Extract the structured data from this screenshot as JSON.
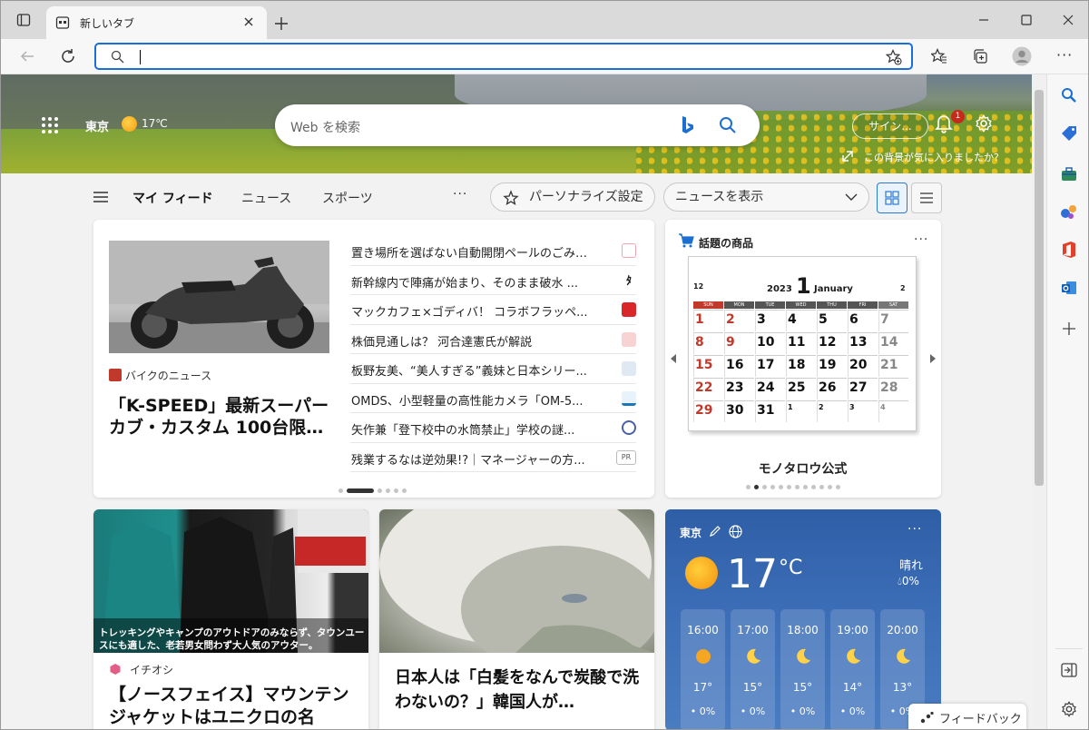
{
  "tab": {
    "title": "新しいタブ"
  },
  "hero": {
    "city": "東京",
    "temp": "17℃",
    "search_placeholder": "Web を検索",
    "signin_label": "サイン...",
    "notif_count": "1",
    "like_bg_label": "この背景が気に入りましたか?"
  },
  "nav": {
    "my_feed": "マイ フィード",
    "news": "ニュース",
    "sports": "スポーツ",
    "more": "···",
    "personalize": "パーソナライズ設定",
    "show_news": "ニュースを表示"
  },
  "main_card": {
    "source": "バイクのニュース",
    "headline": "「K-SPEED」最新スーパーカブ・カスタム 100台限…",
    "list": [
      {
        "text": "置き場所を選ばない自動開閉ペールのごみ…",
        "color": "#f2d6da"
      },
      {
        "text": "新幹線内で陣痛が始まり、そのまま破水 ...",
        "color": "#222222"
      },
      {
        "text": "マックカフェ×ゴディバ！ コラボフラッペ...",
        "color": "#d9262b"
      },
      {
        "text": "株価見通しは？ 河合達憲氏が解説",
        "color": "#f4c7c7"
      },
      {
        "text": "板野友美、“美人すぎる”義妹と日本シリー...",
        "color": "#d9e4f2"
      },
      {
        "text": "OMDS、小型軽量の高性能カメラ「OM-5...",
        "color": "#1a79b5"
      },
      {
        "text": "矢作兼「登下校中の水筒禁止」学校の謎...",
        "color": "#4a5fa8"
      },
      {
        "text": "残業するなは逆効果!?｜マネージャーの方...",
        "color": "#ffffff"
      }
    ],
    "pr_label": "PR"
  },
  "shop_card": {
    "title": "話題の商品",
    "name": "モノタロウ公式",
    "calendar": {
      "year": "2023",
      "month_num": "1",
      "month_name": "January",
      "prev_month": "12",
      "next_month": "2",
      "weekdays": [
        "SUN",
        "MON",
        "TUE",
        "WED",
        "THU",
        "FRI",
        "SAT"
      ],
      "weeks": [
        [
          "1",
          "2",
          "3",
          "4",
          "5",
          "6",
          "7"
        ],
        [
          "8",
          "9",
          "10",
          "11",
          "12",
          "13",
          "14"
        ],
        [
          "15",
          "16",
          "17",
          "18",
          "19",
          "20",
          "21"
        ],
        [
          "22",
          "23",
          "24",
          "25",
          "26",
          "27",
          "28"
        ],
        [
          "29",
          "30",
          "31",
          "1",
          "2",
          "3",
          "4"
        ]
      ]
    }
  },
  "card_jacket": {
    "overlay_text": "トレッキングやキャンプのアウトドアのみならず、タウンユースにも適した、老若男女問わず大人気のアウター。",
    "source": "イチオシ",
    "headline": "【ノースフェイス】マウンテンジャケットはユニクロの名"
  },
  "card_lion": {
    "headline": "日本人は「白髪をなんで炭酸で洗わないの？」韓国人が…"
  },
  "weather": {
    "city": "東京",
    "temp": "17",
    "unit": "°C",
    "condition": "晴れ",
    "precip": "0%",
    "hours": [
      {
        "time": "16:00",
        "icon": "sun",
        "temp": "17°",
        "precip": "0%"
      },
      {
        "time": "17:00",
        "icon": "moon",
        "temp": "15°",
        "precip": "0%"
      },
      {
        "time": "18:00",
        "icon": "moon",
        "temp": "15°",
        "precip": "0%"
      },
      {
        "time": "19:00",
        "icon": "moon",
        "temp": "14°",
        "precip": "0%"
      },
      {
        "time": "20:00",
        "icon": "moon",
        "temp": "13°",
        "precip": "0%"
      }
    ]
  },
  "feedback": {
    "label": "フィードバック"
  }
}
